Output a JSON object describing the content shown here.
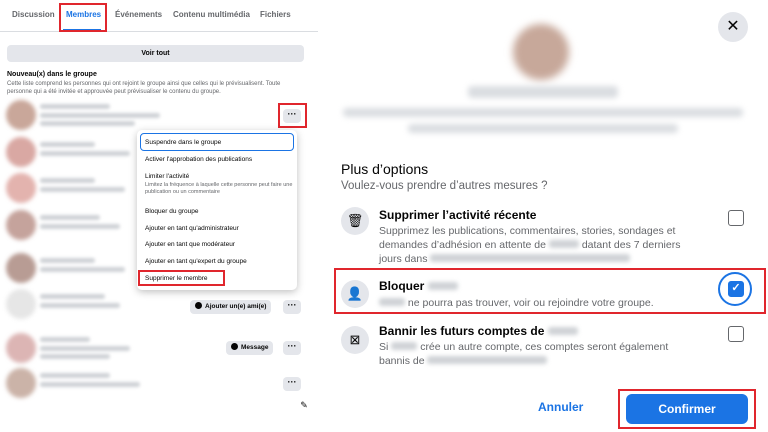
{
  "tabs": [
    "Discussion",
    "Membres",
    "Événements",
    "Contenu multimédia",
    "Fichiers"
  ],
  "voir_tout": "Voir tout",
  "new_members": {
    "title": "Nouveau(x) dans le groupe",
    "desc": "Cette liste comprend les personnes qui ont rejoint le groupe ainsi que celles qui le prévisualisent. Toute personne qui a été invitée et approuvée peut prévisualiser le contenu du groupe."
  },
  "more_label": "···",
  "member_actions": {
    "add_friend": "Ajouter un(e) ami(e)",
    "message": "Message"
  },
  "menu": {
    "suspend": "Suspendre dans le groupe",
    "approve_posts": "Activer l'approbation des publications",
    "limit_activity": "Limiter l'activité",
    "limit_activity_desc": "Limitez la fréquence à laquelle cette personne peut faire une publication ou un commentaire",
    "block": "Bloquer du groupe",
    "add_admin": "Ajouter en tant qu'administrateur",
    "add_moderator": "Ajouter en tant que modérateur",
    "add_expert": "Ajouter en tant qu'expert du groupe",
    "remove": "Supprimer le membre"
  },
  "dialog": {
    "close": "✕",
    "more_options_title": "Plus d’options",
    "more_options_sub": "Voulez-vous prendre d’autres mesures ?",
    "options": [
      {
        "icon": "trash-icon",
        "title": "Supprimer l’activité récente",
        "desc_a": "Supprimez les publications, commentaires, stories, sondages et",
        "desc_b": "demandes d’adhésion en attente de",
        "desc_c": "datant des 7 derniers",
        "desc_d": "jours dans",
        "checked": false
      },
      {
        "icon": "block-user-icon",
        "title": "Bloquer",
        "desc": "ne pourra pas trouver, voir ou rejoindre votre groupe.",
        "checked": true
      },
      {
        "icon": "ban-icon",
        "title": "Bannir les futurs comptes de",
        "desc_a": "Si",
        "desc_b": "crée un autre compte, ces comptes seront également",
        "desc_c": "bannis de",
        "checked": false
      }
    ],
    "cancel": "Annuler",
    "confirm": "Confirmer"
  },
  "colors": {
    "accent": "#1b74e4",
    "highlight": "#e0262d"
  }
}
